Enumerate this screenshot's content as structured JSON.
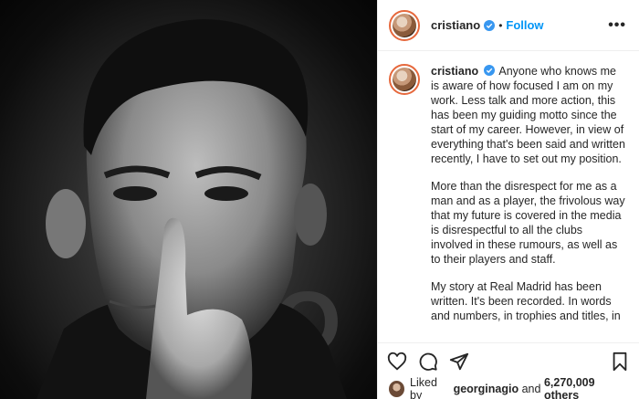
{
  "post": {
    "username": "cristiano",
    "follow_label": "Follow",
    "dot": "•",
    "more_label": "•••",
    "photo_text": "O"
  },
  "caption": {
    "username": "cristiano",
    "paragraph_1": "Anyone who knows me is aware of how focused I am on my work. Less talk and more action, this has been my guiding motto since the start of my career. However, in view of everything that's been said and written recently, I have to set out my position.",
    "paragraph_2": "More than the disrespect for me as a man and as a player, the frivolous way that my future is covered in the media is disrespectful to all the clubs involved in these rumours, as well as to their players and staff.",
    "paragraph_3": "My story at Real Madrid has been written. It's been recorded. In words and numbers, in trophies and titles, in"
  },
  "likes": {
    "prefix": "Liked by",
    "user": "georginagio",
    "and": "and",
    "others": "6,270,009 others"
  },
  "icons": [
    "verified-icon",
    "heart-icon",
    "comment-icon",
    "share-icon",
    "save-icon"
  ],
  "colors": {
    "follow": "#0095f6",
    "verified": "#3897f0"
  }
}
